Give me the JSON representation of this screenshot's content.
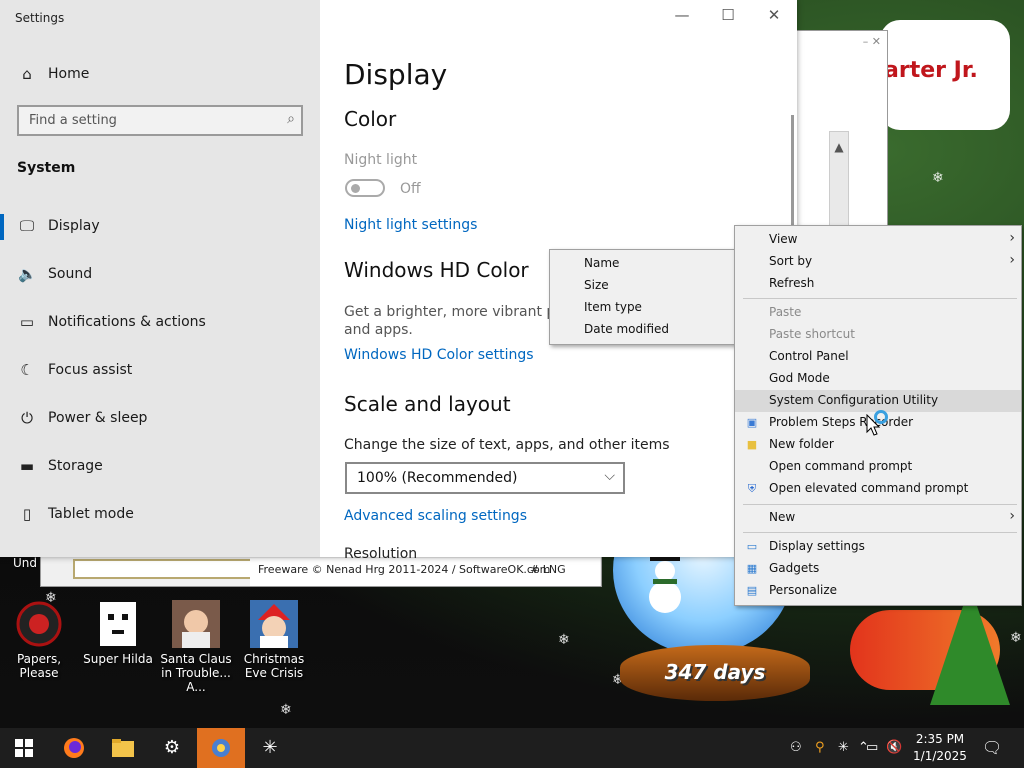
{
  "settings": {
    "window_title": "Settings",
    "home": "Home",
    "search_placeholder": "Find a setting",
    "section": "System",
    "nav": [
      {
        "label": "Display",
        "icon": "monitor-icon",
        "selected": true
      },
      {
        "label": "Sound",
        "icon": "speaker-icon"
      },
      {
        "label": "Notifications & actions",
        "icon": "notification-icon"
      },
      {
        "label": "Focus assist",
        "icon": "moon-icon"
      },
      {
        "label": "Power & sleep",
        "icon": "power-icon"
      },
      {
        "label": "Storage",
        "icon": "storage-icon"
      },
      {
        "label": "Tablet mode",
        "icon": "tablet-icon"
      }
    ],
    "page_title": "Display",
    "color_heading": "Color",
    "night_light_label": "Night light",
    "night_light_state": "Off",
    "night_light_settings": "Night light settings",
    "hd_heading": "Windows HD Color",
    "hd_desc_line1": "Get a brighter, more vibrant pictu",
    "hd_desc_line2": "and apps.",
    "hd_settings": "Windows HD Color settings",
    "scale_heading": "Scale and layout",
    "scale_label": "Change the size of text, apps, and other items",
    "scale_value": "100% (Recommended)",
    "advanced_scaling": "Advanced scaling settings",
    "resolution_label": "Resolution"
  },
  "sort_menu": {
    "items": [
      "Name",
      "Size",
      "Item type",
      "Date modified"
    ]
  },
  "context_menu": {
    "view": "View",
    "sort_by": "Sort by",
    "refresh": "Refresh",
    "paste": "Paste",
    "paste_shortcut": "Paste shortcut",
    "control_panel": "Control Panel",
    "god_mode": "God Mode",
    "msconfig": "System Configuration Utility",
    "psr": "Problem Steps Recorder",
    "new_folder": "New folder",
    "cmd": "Open command prompt",
    "cmd_elevated": "Open elevated command prompt",
    "new": "New",
    "display_settings": "Display settings",
    "gadgets": "Gadgets",
    "personalize": "Personalize"
  },
  "background": {
    "banner_text": "arter Jr.",
    "freeware_text": "Freeware © Nenad Hrg 2011-2024 / SoftwareOK.com",
    "lng_text": "# LNG",
    "cut_label": "Und",
    "days_text": "347 days"
  },
  "desktop_icons": [
    {
      "label": "Papers, Please"
    },
    {
      "label": "Super Hilda"
    },
    {
      "label": "Santa Claus in Trouble... A..."
    },
    {
      "label": "Christmas Eve Crisis"
    }
  ],
  "taskbar": {
    "time": "2:35 PM",
    "date": "1/1/2025"
  },
  "colors": {
    "accent": "#0067c0",
    "taskbar": "#1e1e1e",
    "active_app": "#e07020"
  }
}
